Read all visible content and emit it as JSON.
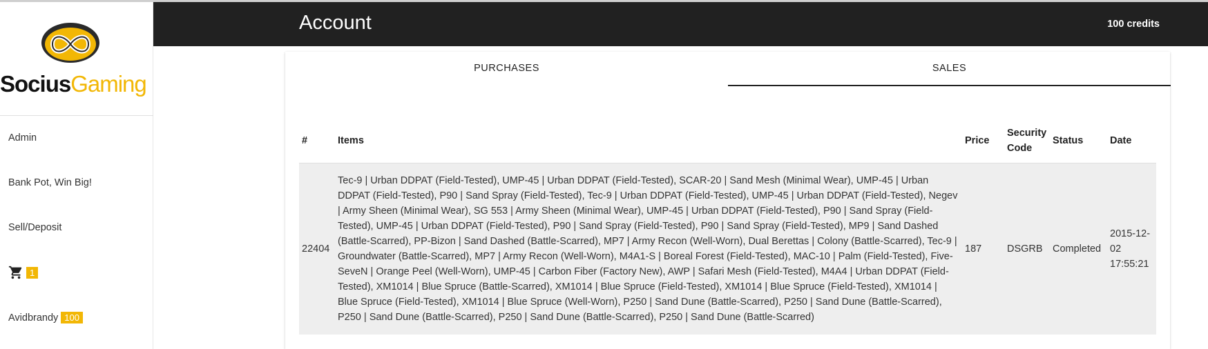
{
  "brand": {
    "name_part1": "Socius",
    "name_part2": "Gaming"
  },
  "sidebar": {
    "items": [
      {
        "label": "Admin"
      },
      {
        "label": "Bank Pot, Win Big!"
      },
      {
        "label": "Sell/Deposit"
      }
    ],
    "cart": {
      "icon": "shopping-cart-icon",
      "count": "1"
    },
    "user": {
      "name": "Avidbrandy",
      "credits": "100"
    }
  },
  "header": {
    "title": "Account",
    "credits": "100 credits"
  },
  "tabs": [
    {
      "label": "PURCHASES",
      "active": false
    },
    {
      "label": "SALES",
      "active": true
    }
  ],
  "table": {
    "columns": [
      "#",
      "Items",
      "Price",
      "Security Code",
      "Status",
      "Date"
    ],
    "rows": [
      {
        "id": "22404",
        "items": "Tec-9 | Urban DDPAT (Field-Tested), UMP-45 | Urban DDPAT (Field-Tested), SCAR-20 | Sand Mesh (Minimal Wear), UMP-45 | Urban DDPAT (Field-Tested), P90 | Sand Spray (Field-Tested), Tec-9 | Urban DDPAT (Field-Tested), UMP-45 | Urban DDPAT (Field-Tested), Negev | Army Sheen (Minimal Wear), SG 553 | Army Sheen (Minimal Wear), UMP-45 | Urban DDPAT (Field-Tested), P90 | Sand Spray (Field-Tested), UMP-45 | Urban DDPAT (Field-Tested), P90 | Sand Spray (Field-Tested), P90 | Sand Spray (Field-Tested), MP9 | Sand Dashed (Battle-Scarred), PP-Bizon | Sand Dashed (Battle-Scarred), MP7 | Army Recon (Well-Worn), Dual Berettas | Colony (Battle-Scarred), Tec-9 | Groundwater (Battle-Scarred), MP7 | Army Recon (Well-Worn), M4A1-S | Boreal Forest (Field-Tested), MAC-10 | Palm (Field-Tested), Five-SeveN | Orange Peel (Well-Worn), UMP-45 | Carbon Fiber (Factory New), AWP | Safari Mesh (Field-Tested), M4A4 | Urban DDPAT (Field-Tested), XM1014 | Blue Spruce (Battle-Scarred), XM1014 | Blue Spruce (Field-Tested), XM1014 | Blue Spruce (Field-Tested), XM1014 | Blue Spruce (Field-Tested), XM1014 | Blue Spruce (Well-Worn), P250 | Sand Dune (Battle-Scarred), P250 | Sand Dune (Battle-Scarred), P250 | Sand Dune (Battle-Scarred), P250 | Sand Dune (Battle-Scarred), P250 | Sand Dune (Battle-Scarred)",
        "price": "187",
        "security_code": "DSGRB",
        "status": "Completed",
        "date": "2015-12-02 17:55:21"
      }
    ]
  },
  "colors": {
    "accent": "#f2b705",
    "header_bg": "#212121",
    "row_bg": "#eeeeee"
  }
}
